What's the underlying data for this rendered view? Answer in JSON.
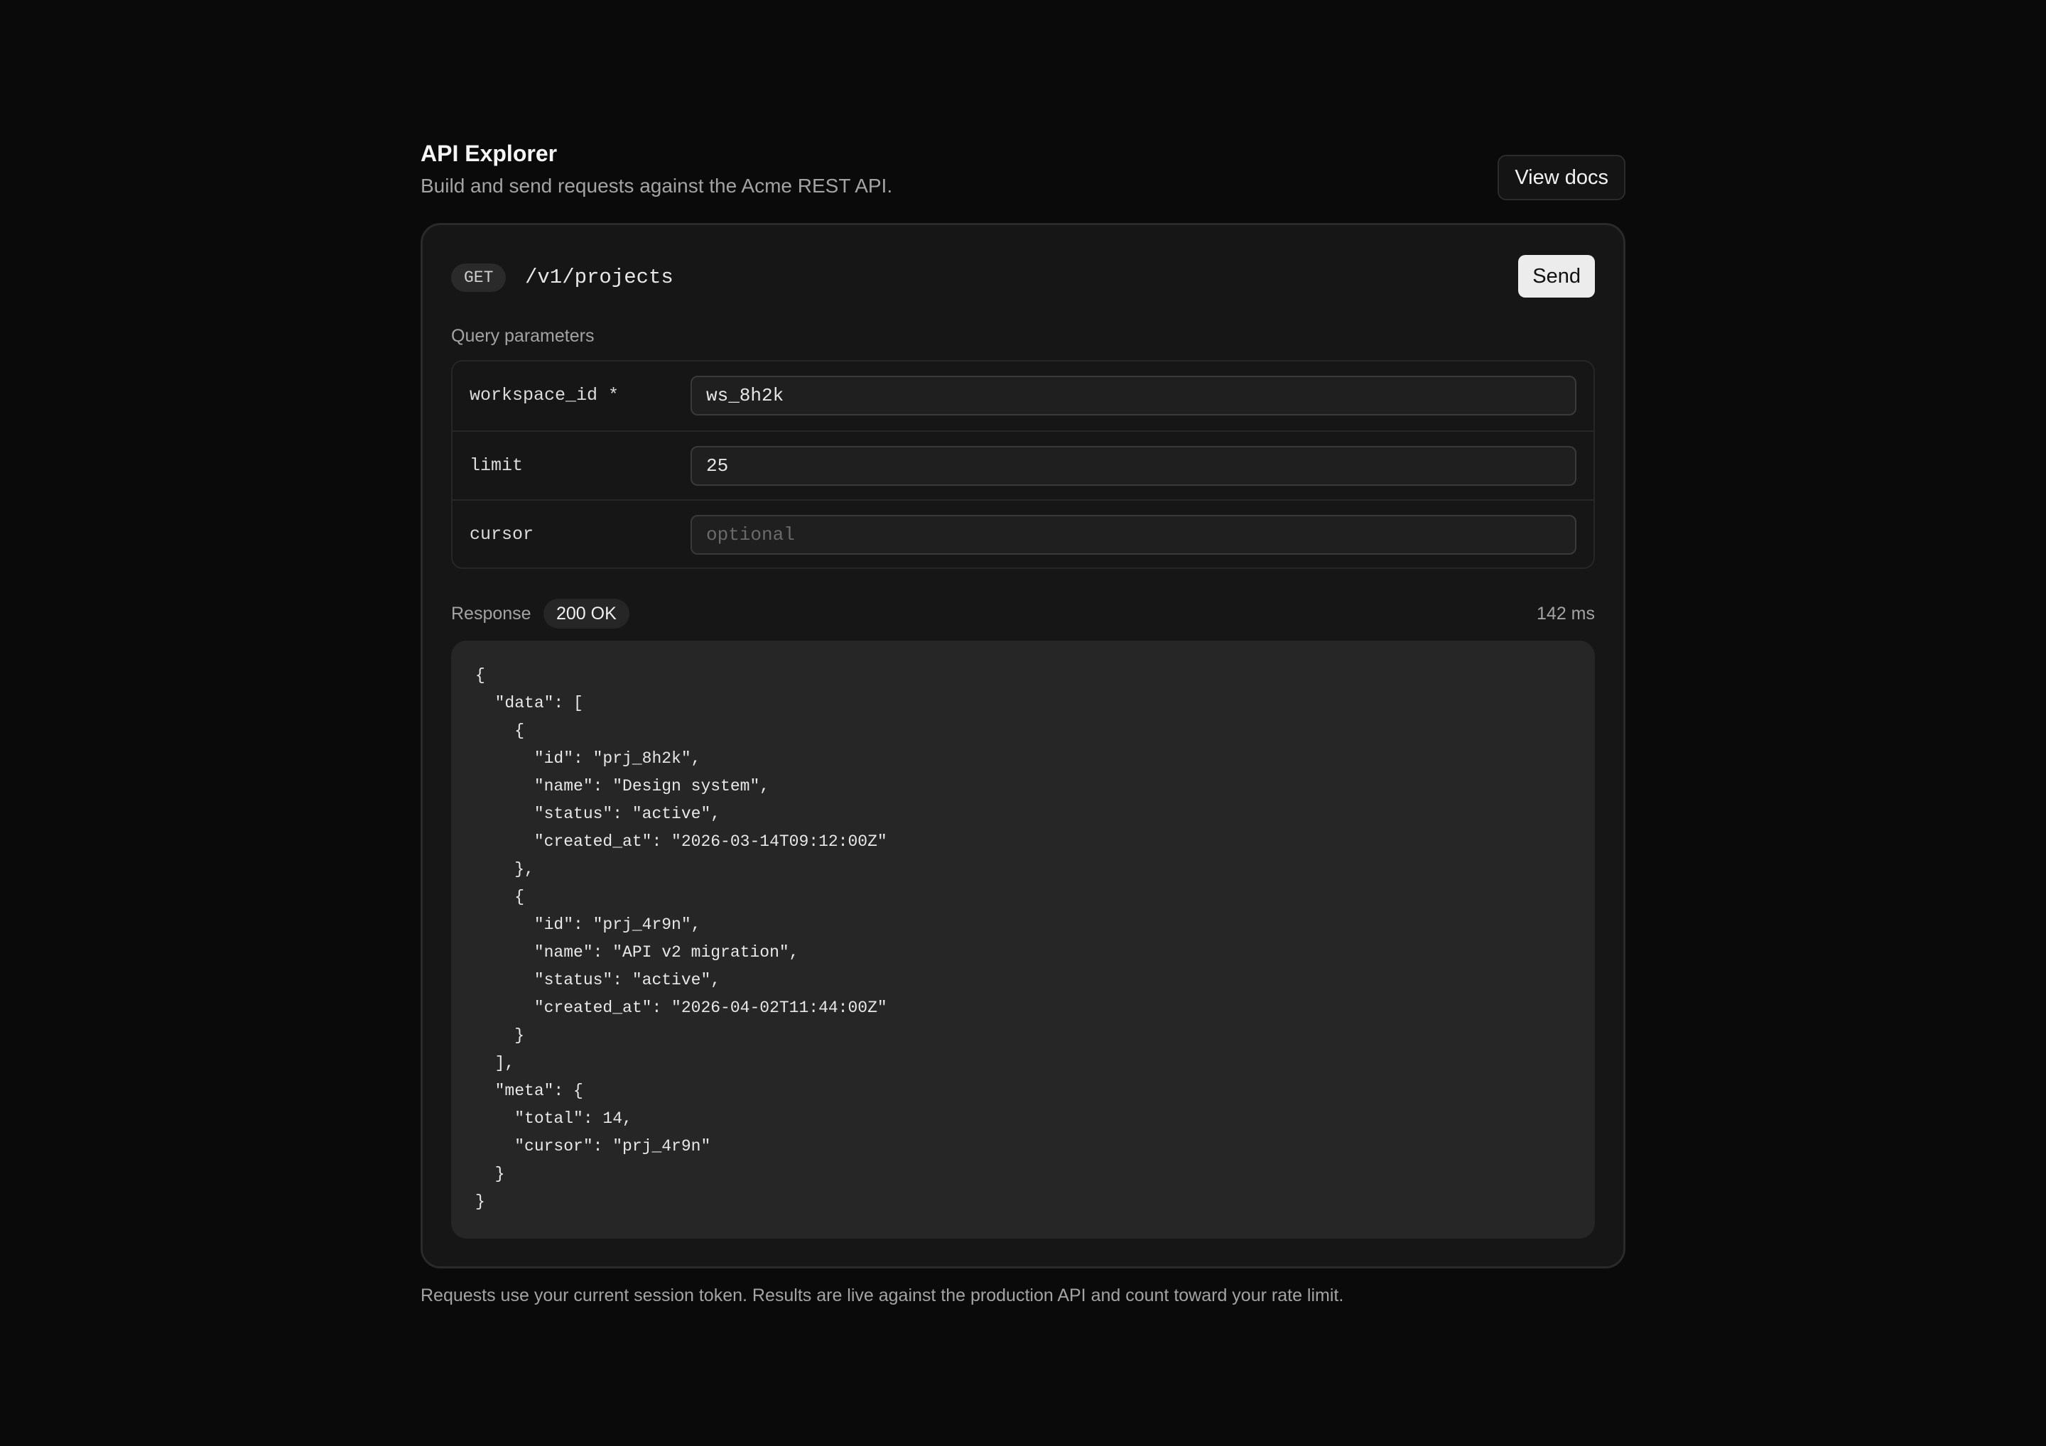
{
  "header": {
    "title": "API Explorer",
    "subtitle": "Build and send requests against the Acme REST API.",
    "docs_label": "View docs"
  },
  "request": {
    "method": "GET",
    "path": "/v1/projects",
    "send_label": "Send"
  },
  "params": {
    "section_label": "Query parameters",
    "rows": [
      {
        "name": "workspace_id *",
        "value": "ws_8h2k",
        "placeholder": ""
      },
      {
        "name": "limit",
        "value": "25",
        "placeholder": ""
      },
      {
        "name": "cursor",
        "value": "",
        "placeholder": "optional"
      }
    ]
  },
  "response": {
    "label": "Response",
    "status": "200 OK",
    "timing": "142 ms",
    "body": "{\n  \"data\": [\n    {\n      \"id\": \"prj_8h2k\",\n      \"name\": \"Design system\",\n      \"status\": \"active\",\n      \"created_at\": \"2026-03-14T09:12:00Z\"\n    },\n    {\n      \"id\": \"prj_4r9n\",\n      \"name\": \"API v2 migration\",\n      \"status\": \"active\",\n      \"created_at\": \"2026-04-02T11:44:00Z\"\n    }\n  ],\n  \"meta\": {\n    \"total\": 14,\n    \"cursor\": \"prj_4r9n\"\n  }\n}"
  },
  "footer": {
    "note": "Requests use your current session token. Results are live against the production API and count toward your rate limit."
  }
}
